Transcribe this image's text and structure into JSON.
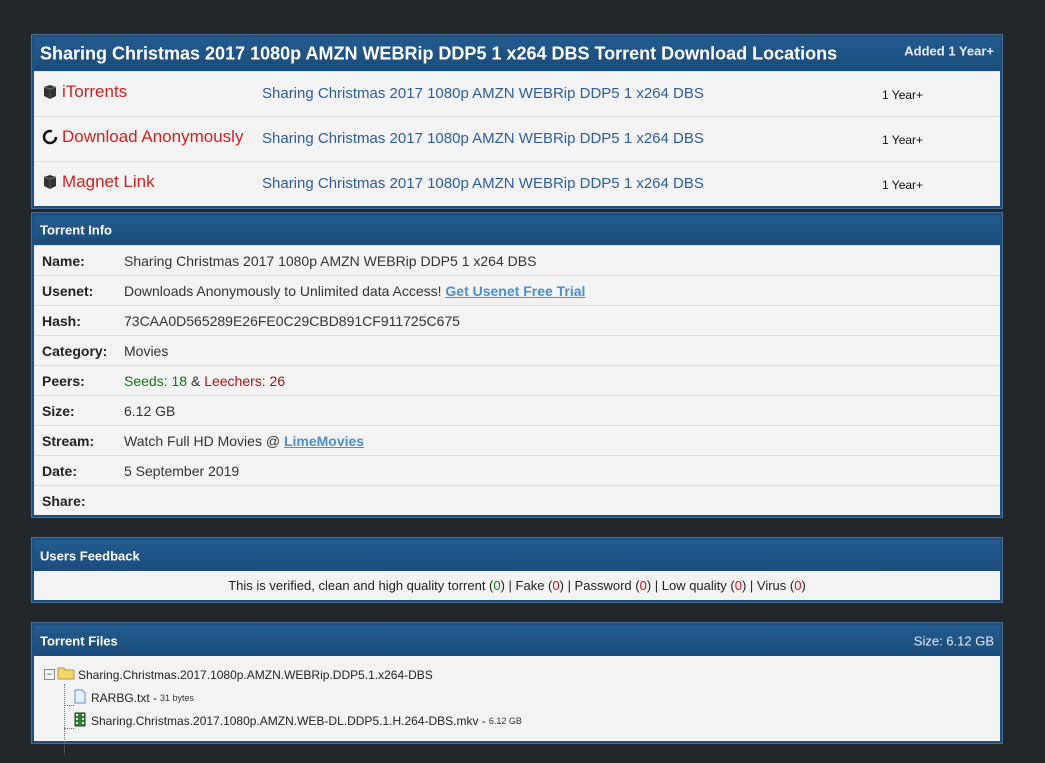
{
  "locations": {
    "title": "Sharing Christmas 2017 1080p AMZN WEBRip DDP5 1 x264 DBS Torrent Download Locations",
    "added": "Added 1 Year+",
    "rows": [
      {
        "name": "iTorrents",
        "icon": "box-icon",
        "link": "Sharing Christmas 2017 1080p AMZN WEBRip DDP5 1 x264 DBS",
        "age": "1 Year+"
      },
      {
        "name": "Download Anonymously",
        "icon": "spinner-icon",
        "link": "Sharing Christmas 2017 1080p AMZN WEBRip DDP5 1 x264 DBS",
        "age": "1 Year+"
      },
      {
        "name": "Magnet Link",
        "icon": "box-icon",
        "link": "Sharing Christmas 2017 1080p AMZN WEBRip DDP5 1 x264 DBS",
        "age": "1 Year+"
      }
    ]
  },
  "info": {
    "title": "Torrent Info",
    "name_label": "Name:",
    "name_value": "Sharing Christmas 2017 1080p AMZN WEBRip DDP5 1 x264 DBS",
    "usenet_label": "Usenet:",
    "usenet_text": "Downloads Anonymously to Unlimited data Access! ",
    "usenet_link": "Get Usenet Free Trial",
    "hash_label": "Hash:",
    "hash_value": "73CAA0D565289E26FE0C29CBD891CF911725C675",
    "category_label": "Category:",
    "category_value": "Movies",
    "peers_label": "Peers:",
    "seeds_text": "Seeds: 18",
    "amp": " & ",
    "leechers_text": "Leechers: 26",
    "size_label": "Size:",
    "size_value": "6.12 GB",
    "stream_label": "Stream:",
    "stream_text": "Watch Full HD Movies @ ",
    "stream_link": "LimeMovies",
    "date_label": "Date:",
    "date_value": "5 September 2019",
    "share_label": "Share:"
  },
  "feedback": {
    "title": "Users Feedback",
    "verified": "This is verified, clean and high quality torrent (",
    "verified_count": "0",
    "fake": ") | Fake (",
    "fake_count": "0",
    "password": ") | Password (",
    "password_count": "0",
    "low": ") | Low quality (",
    "low_count": "0",
    "virus": ") | Virus (",
    "virus_count": "0",
    "close": ")"
  },
  "files": {
    "title": "Torrent Files",
    "size": "Size: 6.12 GB",
    "folder": "Sharing.Christmas.2017.1080p.AMZN.WEBRip.DDP5.1.x264-DBS",
    "items": [
      {
        "name": "RARBG.txt - ",
        "size": "31 bytes",
        "icon": "text-file-icon"
      },
      {
        "name": "Sharing.Christmas.2017.1080p.AMZN.WEB-DL.DDP5.1.H.264-DBS.mkv - ",
        "size": "6.12 GB",
        "icon": "video-file-icon"
      }
    ]
  },
  "colors": {
    "header": "#1a4c7a",
    "link_red": "#cc2222",
    "link_blue": "#2d5f95",
    "background": "#22272b"
  }
}
